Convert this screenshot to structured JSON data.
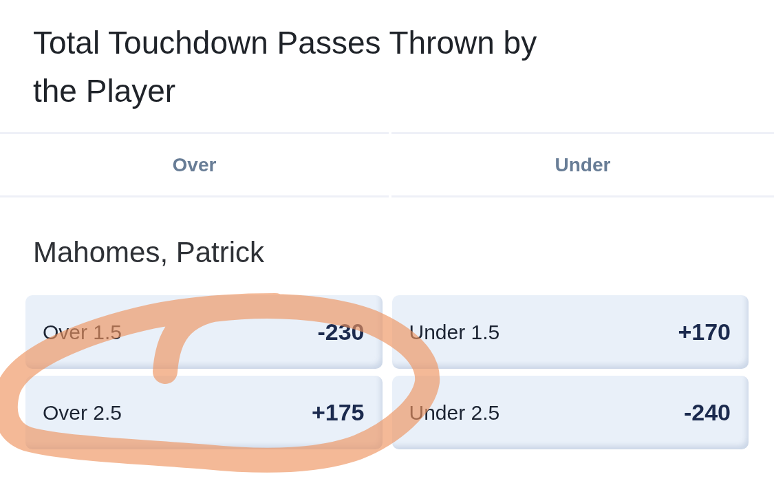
{
  "market": {
    "title": "Total Touchdown Passes Thrown by the Player"
  },
  "columns": [
    "Over",
    "Under"
  ],
  "players": [
    {
      "name": "Mahomes, Patrick",
      "rows": [
        [
          {
            "label": "Over 1.5",
            "odds": "-230"
          },
          {
            "label": "Under 1.5",
            "odds": "+170"
          }
        ],
        [
          {
            "label": "Over 2.5",
            "odds": "+175"
          },
          {
            "label": "Under 2.5",
            "odds": "-240"
          }
        ]
      ]
    }
  ]
}
